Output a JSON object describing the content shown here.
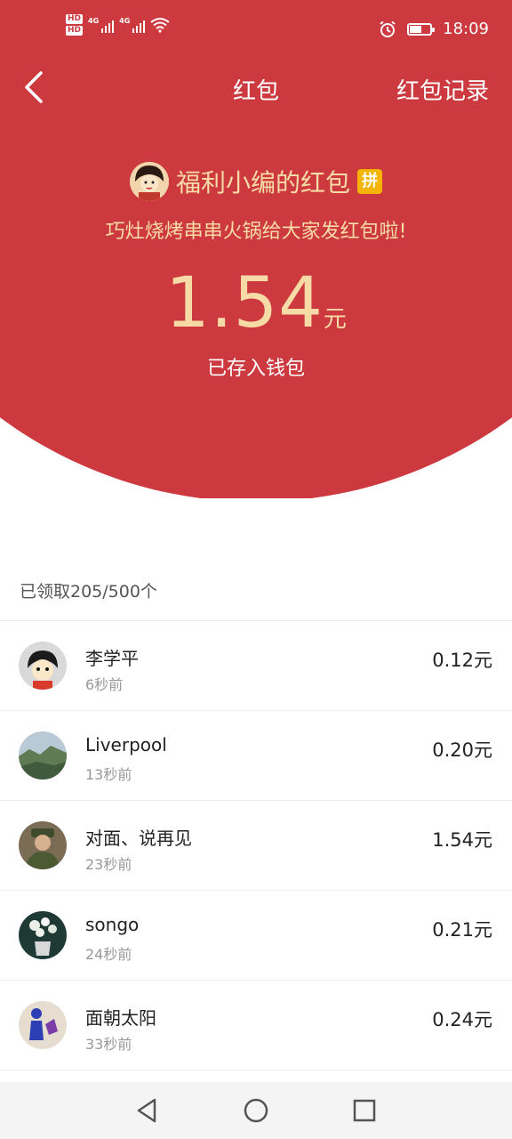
{
  "status_bar": {
    "hd1": "HD",
    "hd2": "HD",
    "net1": "4G",
    "net2": "4G",
    "battery_level": 0.6,
    "time": "18:09"
  },
  "nav": {
    "title": "红包",
    "record_link": "红包记录"
  },
  "sender": {
    "name": "福利小编的红包",
    "badge": "拼"
  },
  "greeting": "巧灶烧烤串串火锅给大家发红包啦!",
  "amount": {
    "value": "1.54",
    "unit": "元"
  },
  "saved_text": "已存入钱包",
  "summary": "已领取205/500个",
  "records": [
    {
      "name": "李学平",
      "time": "6秒前",
      "amount": "0.12元"
    },
    {
      "name": "Liverpool",
      "time": "13秒前",
      "amount": "0.20元"
    },
    {
      "name": "对面、说再见",
      "time": "23秒前",
      "amount": "1.54元"
    },
    {
      "name": "songo",
      "time": "24秒前",
      "amount": "0.21元"
    },
    {
      "name": "面朝太阳",
      "time": "33秒前",
      "amount": "0.24元"
    }
  ],
  "colors": {
    "header_red": "#cc3a3f",
    "gold_text": "#f7dba7"
  },
  "icons": {
    "back": "chevron-left-icon",
    "nav_back": "triangle-back-icon",
    "nav_home": "circle-home-icon",
    "nav_recent": "square-recent-icon"
  }
}
